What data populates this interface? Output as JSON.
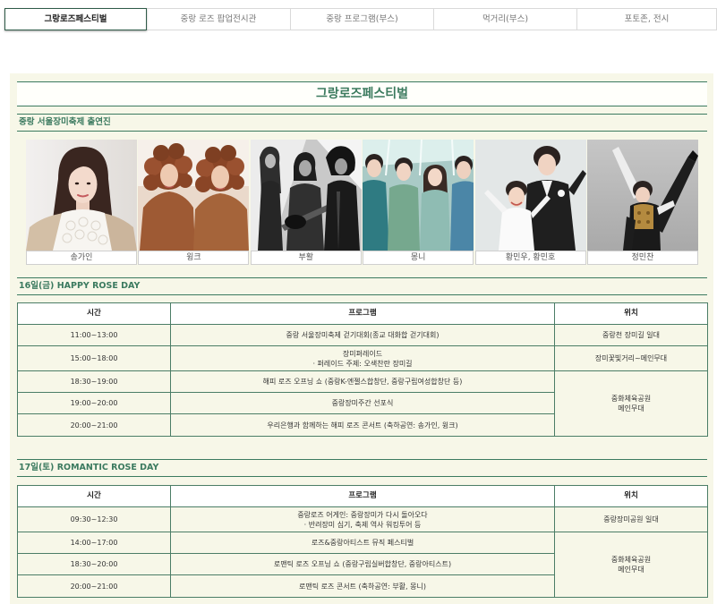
{
  "tabs": [
    {
      "label": "그랑로즈페스티벌",
      "active": true
    },
    {
      "label": "중랑 로즈 팝업전시관",
      "active": false
    },
    {
      "label": "중랑 프로그램(부스)",
      "active": false
    },
    {
      "label": "먹거리(부스)",
      "active": false
    },
    {
      "label": "포토존, 전시",
      "active": false
    }
  ],
  "page_title": "그랑로즈페스티벌",
  "performers_heading": "중랑 서울장미축제 출연진",
  "performers": [
    {
      "name": "송가인"
    },
    {
      "name": "윙크"
    },
    {
      "name": "부활"
    },
    {
      "name": "몽니"
    },
    {
      "name": "황민우, 황민호"
    },
    {
      "name": "정민찬"
    }
  ],
  "schedule_columns": [
    "시간",
    "프로그램",
    "위치"
  ],
  "day1": {
    "heading": "16일(금) HAPPY ROSE DAY",
    "rows": [
      {
        "time": "11:00~13:00",
        "program": [
          "중랑 서울장미축제 걷기대회(종교 대화합 걷기대회)"
        ],
        "location": [
          "중랑천 장미길 일대"
        ]
      },
      {
        "time": "15:00~18:00",
        "program": [
          "장미퍼레이드",
          "· 퍼레이드 주제: 오색찬란 장미길"
        ],
        "location": [
          "장미꽃빛거리~메인무대"
        ]
      },
      {
        "time": "18:30~19:00",
        "program": [
          "해피 로즈 오프닝 쇼 (중랑K-엔젤스합창단, 중랑구립여성합창단 등)"
        ],
        "location": [
          "중화체육공원",
          "메인무대"
        ]
      },
      {
        "time": "19:00~20:00",
        "program": [
          "중랑장미주간 선포식"
        ]
      },
      {
        "time": "20:00~21:00",
        "program": [
          "우리은행과 함께하는 해피 로즈 콘서트 (축하공연: 송가인, 윙크)"
        ]
      }
    ]
  },
  "day2": {
    "heading": "17일(토) ROMANTIC ROSE DAY",
    "rows": [
      {
        "time": "09:30~12:30",
        "program": [
          "중랑로즈 어게인: 중랑장미가 다시 돌아오다",
          "· 반려장미 심기, 축제 역사 워킹투어 등"
        ],
        "location": [
          "중랑장미공원 일대"
        ]
      },
      {
        "time": "14:00~17:00",
        "program": [
          "로즈&중랑아티스트 뮤직 페스티벌"
        ],
        "location": [
          "중화체육공원",
          "메인무대"
        ]
      },
      {
        "time": "18:30~20:00",
        "program": [
          "로맨틱 로즈 오프닝 쇼 (중랑구립실버합창단, 중랑아티스트)"
        ]
      },
      {
        "time": "20:00~21:00",
        "program": [
          "로맨틱 로즈 콘서트 (축하공연: 부활, 몽니)"
        ]
      }
    ]
  },
  "colors": {
    "accent": "#3b7a5f",
    "panel_background": "#f7f7e8",
    "table_border": "#4b7d66",
    "active_tab_border": "#2f5b48"
  }
}
